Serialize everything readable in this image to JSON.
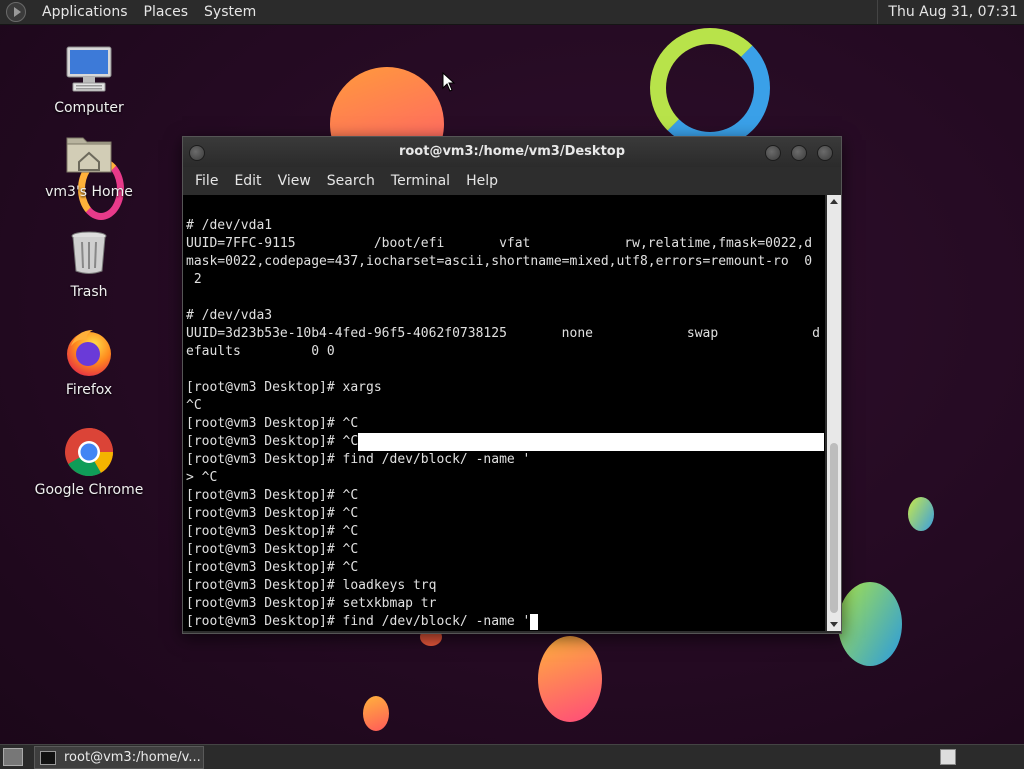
{
  "top_panel": {
    "menus": [
      "Applications",
      "Places",
      "System"
    ],
    "clock": "Thu Aug 31, 07:31"
  },
  "desktop_icons": [
    {
      "label": "Computer",
      "icon": "computer-icon"
    },
    {
      "label": "vm3's Home",
      "icon": "home-folder-icon"
    },
    {
      "label": "Trash",
      "icon": "trash-icon"
    },
    {
      "label": "Firefox",
      "icon": "firefox-icon"
    },
    {
      "label": "Google Chrome",
      "icon": "chrome-icon"
    }
  ],
  "terminal": {
    "title": "root@vm3:/home/vm3/Desktop",
    "menu": [
      "File",
      "Edit",
      "View",
      "Search",
      "Terminal",
      "Help"
    ],
    "lines": [
      "# /dev/vda1",
      "UUID=7FFC-9115          /boot/efi       vfat            rw,relatime,fmask=0022,d",
      "mask=0022,codepage=437,iocharset=ascii,shortname=mixed,utf8,errors=remount-ro  0",
      " 2",
      "",
      "# /dev/vda3",
      "UUID=3d23b53e-10b4-4fed-96f5-4062f0738125       none            swap            d",
      "efaults         0 0",
      "",
      "[root@vm3 Desktop]# xargs",
      "^C",
      "[root@vm3 Desktop]# ^C",
      "[root@vm3 Desktop]# ^C",
      "[root@vm3 Desktop]# find /dev/block/ -name '",
      "> ^C",
      "[root@vm3 Desktop]# ^C",
      "[root@vm3 Desktop]# ^C",
      "[root@vm3 Desktop]# ^C",
      "[root@vm3 Desktop]# ^C",
      "[root@vm3 Desktop]# ^C",
      "[root@vm3 Desktop]# loadkeys trq",
      "[root@vm3 Desktop]# setxkbmap tr",
      "[root@vm3 Desktop]# find /dev/block/ -name '"
    ]
  },
  "taskbar": {
    "task_label": "root@vm3:/home/v..."
  }
}
